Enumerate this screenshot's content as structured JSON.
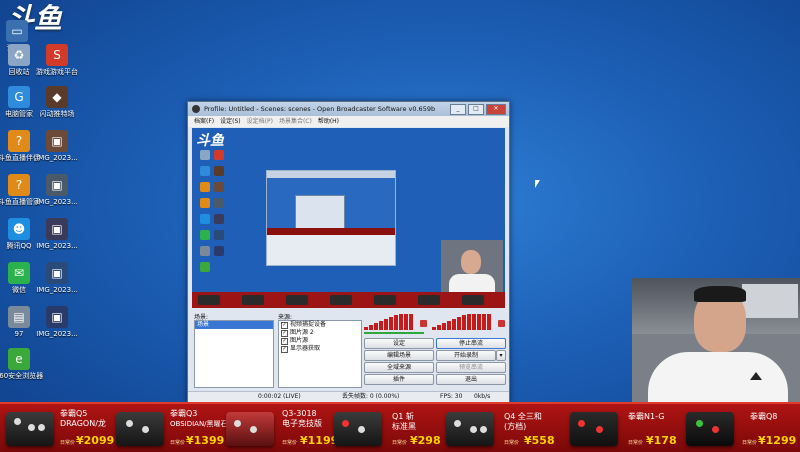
{
  "desktop": {
    "logo_text": "斗鱼",
    "icons": [
      {
        "label": "计算机",
        "color": "#3a6fb0"
      },
      {
        "label": "回收站",
        "color": "#8aa6c4"
      },
      {
        "label": "游戏游戏平台",
        "color": "#d23a2a"
      },
      {
        "label": "电脑管家",
        "color": "#2f8bdc"
      },
      {
        "label": "闪动推特场",
        "color": "#5a3a2a"
      },
      {
        "label": "斗鱼直播伴侣",
        "color": "#e08a1a"
      },
      {
        "label": "IMG_2023...",
        "color": "#6b4a3a"
      },
      {
        "label": "斗鱼直播管家",
        "color": "#e08a1a"
      },
      {
        "label": "IMG_2023...",
        "color": "#4a5a6a"
      },
      {
        "label": "腾讯QQ",
        "color": "#1e8fe0"
      },
      {
        "label": "IMG_2023...",
        "color": "#3a3a5a"
      },
      {
        "label": "微信",
        "color": "#2bb24c"
      },
      {
        "label": "IMG_2023...",
        "color": "#2a4a7a"
      },
      {
        "label": "97",
        "color": "#7a8a9a"
      },
      {
        "label": "IMG_2023...",
        "color": "#2a3a6a"
      },
      {
        "label": "360安全浏览器",
        "color": "#3aa83a"
      }
    ]
  },
  "obs": {
    "title": "Profile: Untitled - Scenes: scenes - Open Broadcaster Software v0.659b",
    "menu": [
      "档案(F)",
      "设定(S)",
      "设定档(P)",
      "场景集合(C)",
      "帮助(H)"
    ],
    "scenes_label": "场景:",
    "scenes": [
      "场景"
    ],
    "sources_label": "来源:",
    "sources": [
      "视频捕捉设备",
      "图片源 2",
      "图片源",
      "显示器获取"
    ],
    "buttons": {
      "settings": "设定",
      "stop_stream": "停止串流",
      "edit_scene": "编辑场景",
      "start_record": "开始录制",
      "global_sources": "全域来源",
      "preview_stream": "预览串流",
      "plugins": "插件",
      "exit": "退出"
    },
    "status": {
      "time": "0:00:02 (LIVE)",
      "dropped": "丢失帧数: 0 (0.00%)",
      "fps": "FPS: 30",
      "bitrate": "0kb/s"
    }
  },
  "ads": {
    "products": [
      {
        "name": "拳霸Q5",
        "sub": "DRAGON/龙",
        "tag": "日常价",
        "price": "¥2099"
      },
      {
        "name": "拳霸Q3",
        "sub": "OBSIDIAN/黑曜石",
        "tag": "日常价",
        "price": "¥1399"
      },
      {
        "name": "Q3-3018",
        "sub": "电子竞技版",
        "tag": "日常价",
        "price": "¥1199"
      },
      {
        "name": "Q1 斩",
        "sub": "标准黑",
        "tag": "日常价",
        "price": "¥298"
      },
      {
        "name": "Q4 全三和",
        "sub": "(方档)",
        "tag": "日常价",
        "price": "¥558"
      },
      {
        "name": "拳霸N1-G",
        "sub": "",
        "tag": "日常价",
        "price": "¥178"
      },
      {
        "name": "拳霸Q8",
        "sub": "",
        "tag": "日常价",
        "price": "¥1299"
      }
    ]
  },
  "colors": {
    "accent": "#3a77d4",
    "ad_red": "#b01414",
    "price": "#ffd400"
  }
}
